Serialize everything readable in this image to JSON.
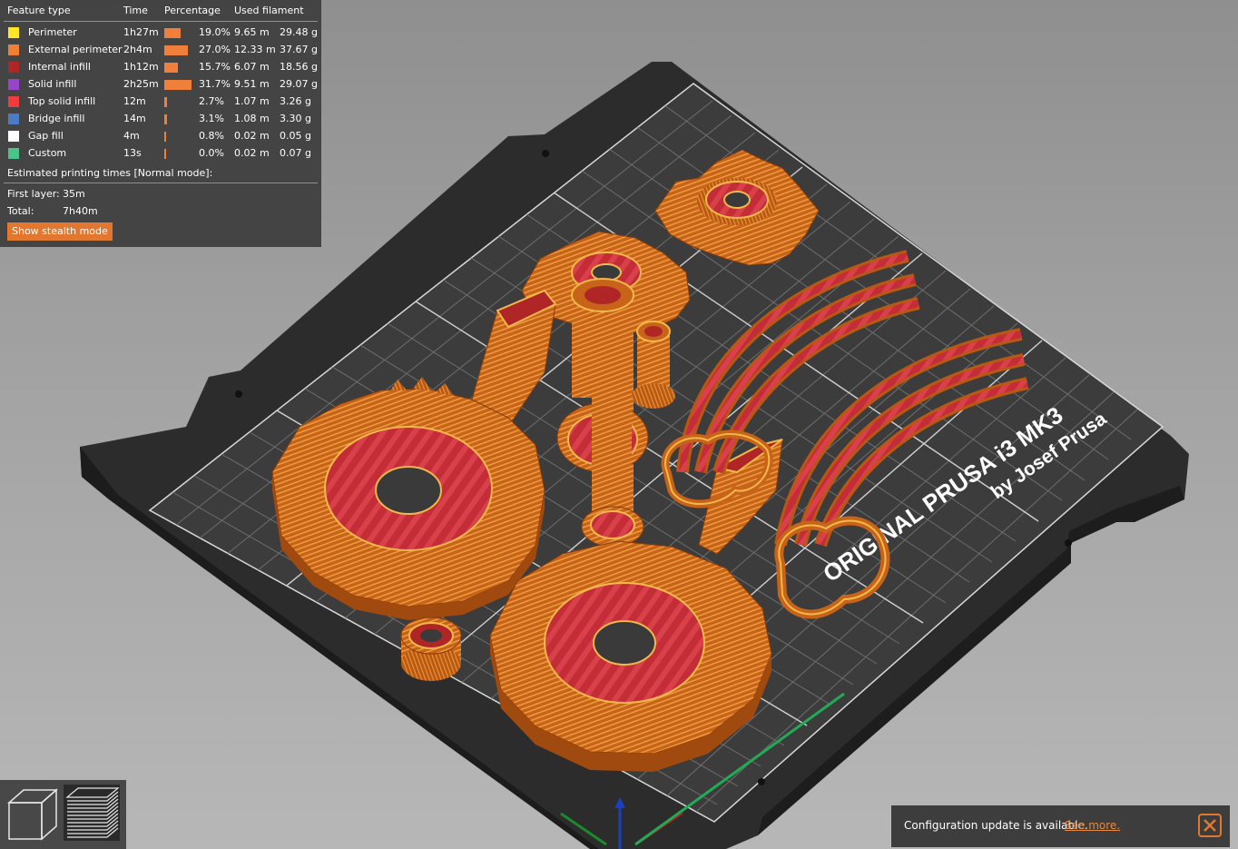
{
  "legend": {
    "headers": {
      "feature": "Feature type",
      "time": "Time",
      "percentage": "Percentage",
      "filament": "Used filament"
    },
    "rows": [
      {
        "name": "Perimeter",
        "color": "#ffe62b",
        "time": "1h27m",
        "percent": "19.0%",
        "percent_value": 19.0,
        "length": "9.65 m",
        "weight": "29.48 g"
      },
      {
        "name": "External perimeter",
        "color": "#f08033",
        "time": "2h4m",
        "percent": "27.0%",
        "percent_value": 27.0,
        "length": "12.33 m",
        "weight": "37.67 g"
      },
      {
        "name": "Internal infill",
        "color": "#b02626",
        "time": "1h12m",
        "percent": "15.7%",
        "percent_value": 15.7,
        "length": "6.07 m",
        "weight": "18.56 g"
      },
      {
        "name": "Solid infill",
        "color": "#9944cc",
        "time": "2h25m",
        "percent": "31.7%",
        "percent_value": 31.7,
        "length": "9.51 m",
        "weight": "29.07 g"
      },
      {
        "name": "Top solid infill",
        "color": "#f03c3c",
        "time": "12m",
        "percent": "2.7%",
        "percent_value": 2.7,
        "length": "1.07 m",
        "weight": "3.26 g"
      },
      {
        "name": "Bridge infill",
        "color": "#4b7bc4",
        "time": "14m",
        "percent": "3.1%",
        "percent_value": 3.1,
        "length": "1.08 m",
        "weight": "3.30 g"
      },
      {
        "name": "Gap fill",
        "color": "#ffffff",
        "time": "4m",
        "percent": "0.8%",
        "percent_value": 0.8,
        "length": "0.02 m",
        "weight": "0.05 g"
      },
      {
        "name": "Custom",
        "color": "#4ac488",
        "time": "13s",
        "percent": "0.0%",
        "percent_value": 0.0,
        "length": "0.02 m",
        "weight": "0.07 g"
      }
    ],
    "estimated_title": "Estimated printing times [Normal mode]:",
    "first_layer_label": "First layer:",
    "first_layer_value": "35m",
    "total_label": "Total:",
    "total_value": "7h40m",
    "stealth_button": "Show stealth mode"
  },
  "bed": {
    "label_line1": "ORIGINAL PRUSA i3  MK3",
    "label_line2": "by Josef Prusa"
  },
  "view_toggles": {
    "items": [
      {
        "icon": "cube-icon",
        "selected": false
      },
      {
        "icon": "layers-icon",
        "selected": true
      }
    ]
  },
  "notification": {
    "text": "Configuration update is available.",
    "link": "See more.",
    "close_icon": "close-icon"
  },
  "colors": {
    "accent": "#e2772f",
    "print_orange": "#c8641a",
    "print_red": "#c7303a",
    "bed_dark": "#2b2b2b",
    "grid_line": "#7a7a7a"
  }
}
